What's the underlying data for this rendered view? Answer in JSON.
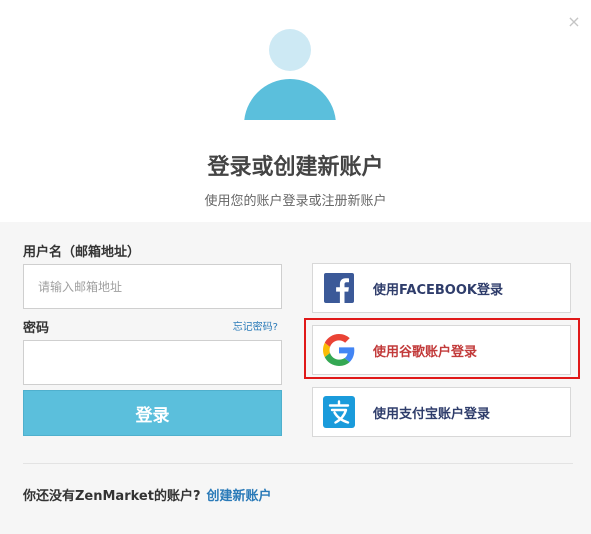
{
  "dialog": {
    "title": "登录或创建新账户",
    "subtitle": "使用您的账户登录或注册新账户",
    "close_symbol": "×"
  },
  "form": {
    "email_label": "用户名（邮箱地址）",
    "email_placeholder": "请输入邮箱地址",
    "email_value": "",
    "password_label": "密码",
    "forgot_link": "忘记密码?",
    "password_value": "",
    "login_button": "登录"
  },
  "social": {
    "facebook_label": "使用FACEBOOK登录",
    "google_label": "使用谷歌账户登录",
    "alipay_label": "使用支付宝账户登录",
    "facebook_icon": "facebook-icon",
    "google_icon": "google-icon",
    "alipay_icon": "alipay-icon",
    "highlight_color": "#e01919"
  },
  "footer": {
    "question": "你还没有ZenMarket的账户?",
    "create_link": "创建新账户"
  },
  "colors": {
    "accent": "#5bbfdc",
    "link": "#2a7ab8",
    "facebook": "#3b5998",
    "alipay": "#1a9bdb"
  }
}
